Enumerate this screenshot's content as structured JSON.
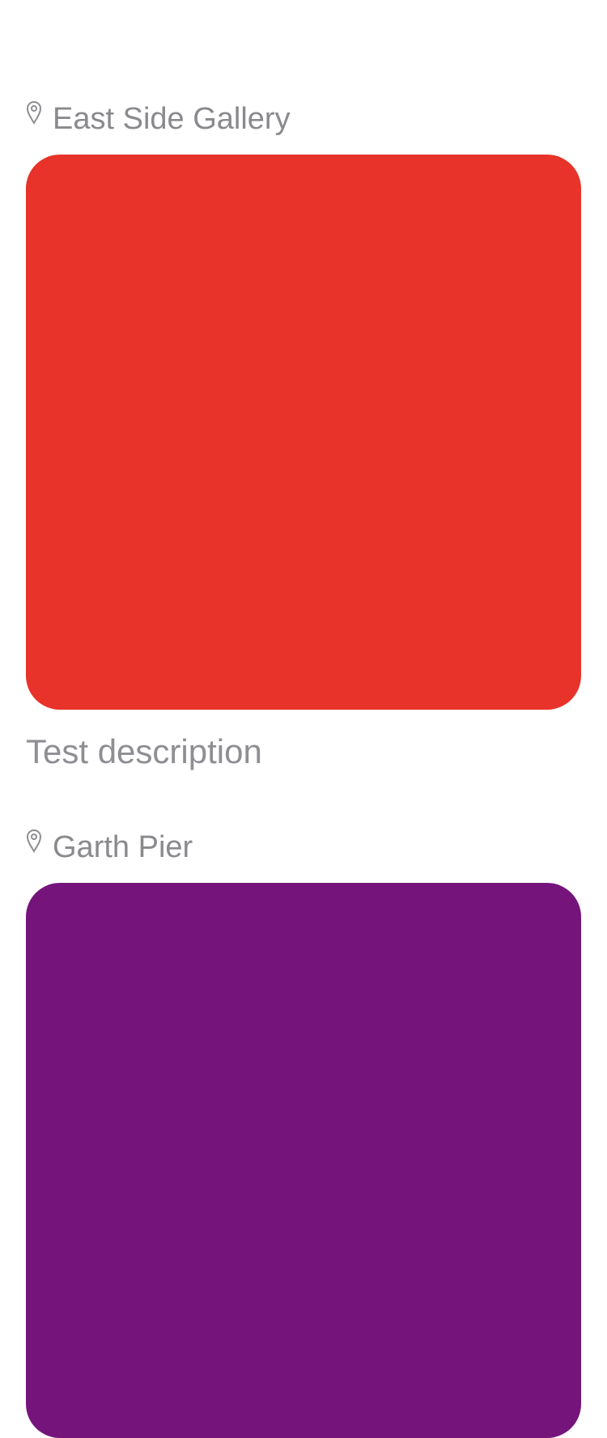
{
  "feed": {
    "posts": [
      {
        "location": "East Side Gallery",
        "image_color": "#E8332A",
        "description": "Test description"
      },
      {
        "location": "Garth Pier",
        "image_color": "#75157C"
      }
    ]
  },
  "colors": {
    "secondary_text": "#8a8a8e",
    "icon": "#8e8e93",
    "background": "#ffffff"
  },
  "icons": {
    "location": "map-pin-icon"
  }
}
